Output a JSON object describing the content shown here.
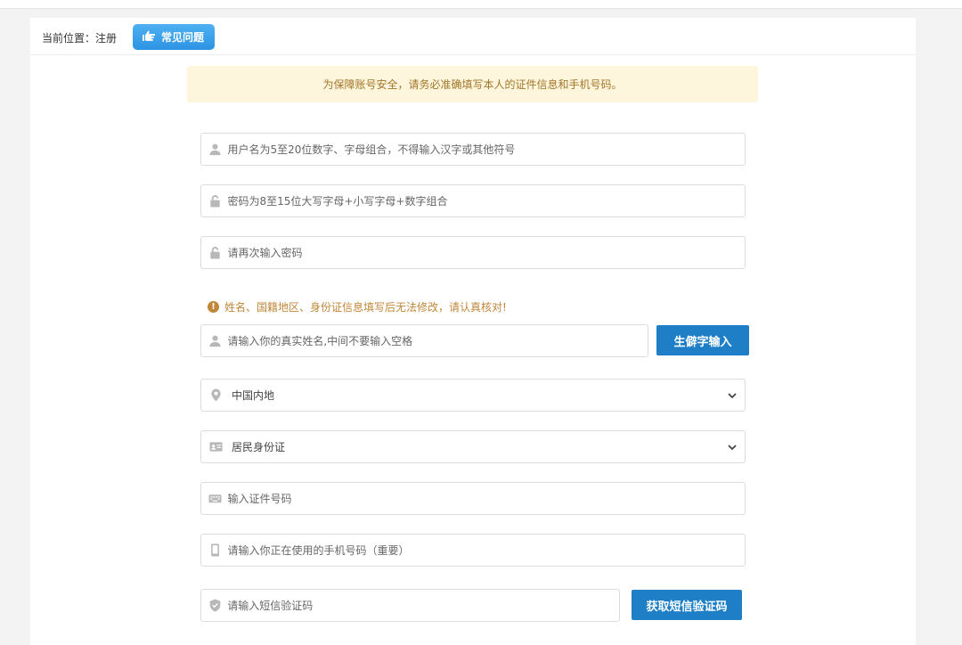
{
  "breadcrumb": {
    "label": "当前位置：注册"
  },
  "faq_button": {
    "label": "常见问题"
  },
  "notice": {
    "text": "为保障账号安全，请务必准确填写本人的证件信息和手机号码。"
  },
  "fields": {
    "username": {
      "placeholder": "用户名为5至20位数字、字母组合，不得输入汉字或其他符号",
      "icon": "user-icon"
    },
    "password": {
      "placeholder": "密码为8至15位大写字母+小写字母+数字组合",
      "icon": "lock-icon"
    },
    "password_confirm": {
      "placeholder": "请再次输入密码",
      "icon": "lock-icon"
    },
    "real_name": {
      "placeholder": "请输入你的真实姓名,中间不要输入空格",
      "icon": "user-icon"
    },
    "region": {
      "value": "中国内地",
      "icon": "location-pin-icon"
    },
    "id_type": {
      "value": "居民身份证",
      "icon": "id-card-icon"
    },
    "id_number": {
      "placeholder": "输入证件号码",
      "icon": "keyboard-icon"
    },
    "phone": {
      "placeholder": "请输入你正在使用的手机号码（重要）",
      "icon": "mobile-phone-icon"
    },
    "sms_code": {
      "placeholder": "请输入短信验证码",
      "icon": "shield-icon"
    }
  },
  "warning": {
    "text": "姓名、国籍地区、身份证信息填写后无法修改，请认真核对!",
    "icon": "exclamation-circle-icon"
  },
  "buttons": {
    "rare_char": "生僻字输入",
    "get_sms": "获取短信验证码"
  },
  "colors": {
    "primary": "#1e7fc6",
    "faq": "#2d94e3",
    "notice_bg": "#fdf6dc",
    "notice_text": "#a4752a",
    "warning": "#c0873a"
  }
}
